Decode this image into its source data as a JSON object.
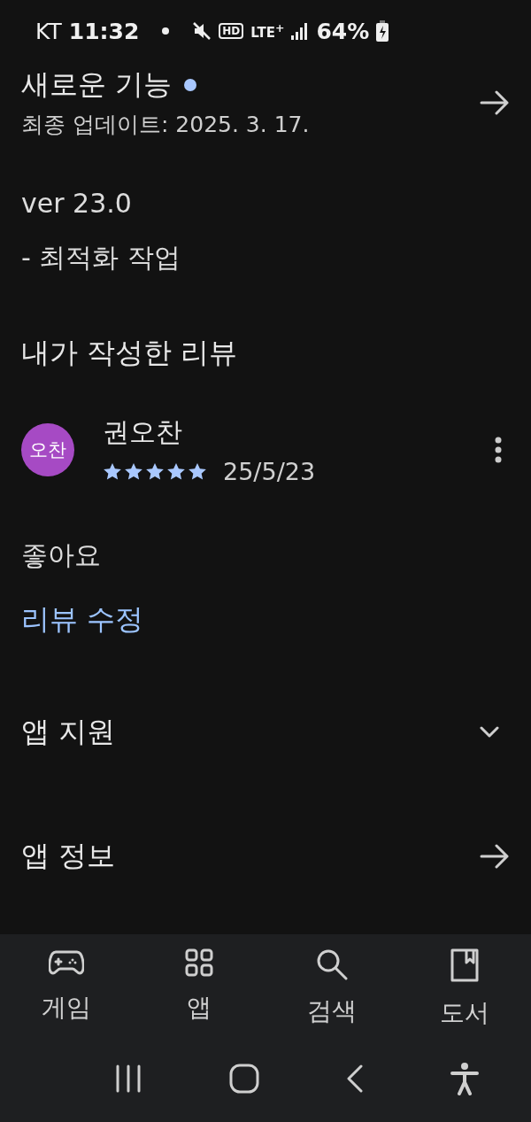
{
  "status_bar": {
    "carrier": "KT",
    "time": "11:32",
    "hd": "HD",
    "network": "LTE$^{+}$",
    "battery": "64%"
  },
  "whats_new": {
    "title": "새로운 기능",
    "unread": true,
    "updated": "최종 업데이트: 2025. 3. 17.",
    "version": "ver 23.0",
    "notes": "- 최적화 작업"
  },
  "my_review": {
    "heading": "내가 작성한 리뷰",
    "avatar": "오찬",
    "author": "권오찬",
    "stars": 5,
    "date": "25/5/23",
    "text": "좋아요",
    "edit_link": "리뷰 수정"
  },
  "sections": [
    {
      "kind": "expand",
      "label": "앱 지원"
    },
    {
      "kind": "link",
      "label": "앱 정보"
    }
  ],
  "bottom_nav": [
    {
      "kind": "games",
      "label": "게임"
    },
    {
      "kind": "apps",
      "label": "앱"
    },
    {
      "kind": "search",
      "label": "검색"
    },
    {
      "kind": "books",
      "label": "도서"
    }
  ]
}
